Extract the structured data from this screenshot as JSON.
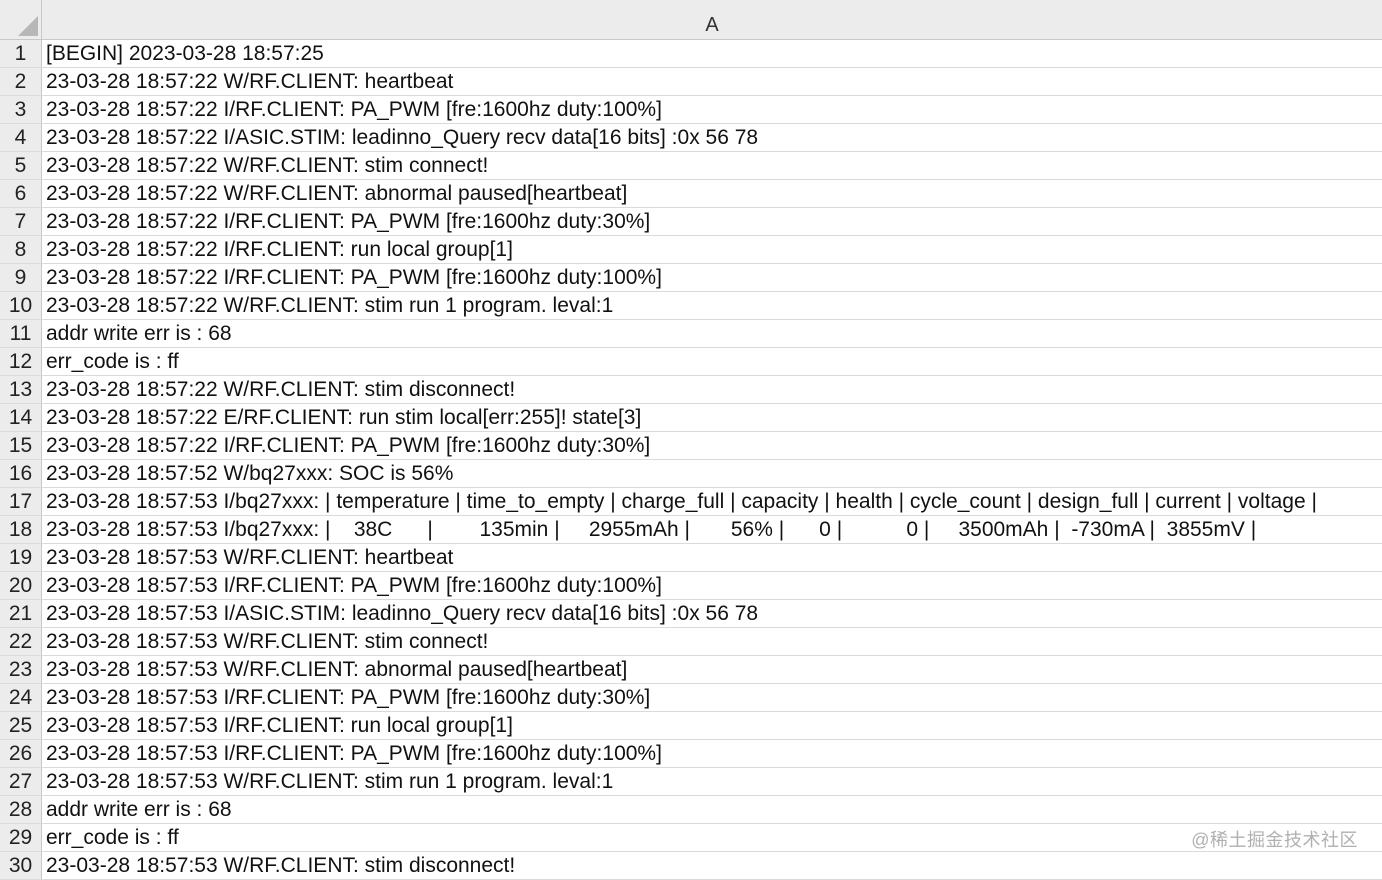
{
  "sheet": {
    "column_header": "A",
    "rows": [
      {
        "num": "1",
        "text": "[BEGIN] 2023-03-28 18:57:25"
      },
      {
        "num": "2",
        "text": "23-03-28 18:57:22 W/RF.CLIENT: heartbeat"
      },
      {
        "num": "3",
        "text": "23-03-28 18:57:22 I/RF.CLIENT: PA_PWM [fre:1600hz duty:100%]"
      },
      {
        "num": "4",
        "text": "23-03-28 18:57:22 I/ASIC.STIM: leadinno_Query recv data[16 bits] :0x 56 78"
      },
      {
        "num": "5",
        "text": "23-03-28 18:57:22 W/RF.CLIENT: stim connect!"
      },
      {
        "num": "6",
        "text": "23-03-28 18:57:22 W/RF.CLIENT: abnormal paused[heartbeat]"
      },
      {
        "num": "7",
        "text": "23-03-28 18:57:22 I/RF.CLIENT: PA_PWM [fre:1600hz duty:30%]"
      },
      {
        "num": "8",
        "text": "23-03-28 18:57:22 I/RF.CLIENT: run local group[1]"
      },
      {
        "num": "9",
        "text": "23-03-28 18:57:22 I/RF.CLIENT: PA_PWM [fre:1600hz duty:100%]"
      },
      {
        "num": "10",
        "text": "23-03-28 18:57:22 W/RF.CLIENT: stim run 1 program. leval:1"
      },
      {
        "num": "11",
        "text": "addr write err is : 68"
      },
      {
        "num": "12",
        "text": "err_code is : ff"
      },
      {
        "num": "13",
        "text": "23-03-28 18:57:22 W/RF.CLIENT: stim disconnect!"
      },
      {
        "num": "14",
        "text": "23-03-28 18:57:22 E/RF.CLIENT: run stim local[err:255]! state[3]"
      },
      {
        "num": "15",
        "text": "23-03-28 18:57:22 I/RF.CLIENT: PA_PWM [fre:1600hz duty:30%]"
      },
      {
        "num": "16",
        "text": "23-03-28 18:57:52 W/bq27xxx: SOC is 56%"
      },
      {
        "num": "17",
        "text": "23-03-28 18:57:53 I/bq27xxx: | temperature | time_to_empty | charge_full | capacity | health | cycle_count | design_full | current | voltage |"
      },
      {
        "num": "18",
        "text": "23-03-28 18:57:53 I/bq27xxx: |    38C      |        135min |     2955mAh |       56% |      0 |           0 |     3500mAh |  -730mA |  3855mV |"
      },
      {
        "num": "19",
        "text": "23-03-28 18:57:53 W/RF.CLIENT: heartbeat"
      },
      {
        "num": "20",
        "text": "23-03-28 18:57:53 I/RF.CLIENT: PA_PWM [fre:1600hz duty:100%]"
      },
      {
        "num": "21",
        "text": "23-03-28 18:57:53 I/ASIC.STIM: leadinno_Query recv data[16 bits] :0x 56 78"
      },
      {
        "num": "22",
        "text": "23-03-28 18:57:53 W/RF.CLIENT: stim connect!"
      },
      {
        "num": "23",
        "text": "23-03-28 18:57:53 W/RF.CLIENT: abnormal paused[heartbeat]"
      },
      {
        "num": "24",
        "text": "23-03-28 18:57:53 I/RF.CLIENT: PA_PWM [fre:1600hz duty:30%]"
      },
      {
        "num": "25",
        "text": "23-03-28 18:57:53 I/RF.CLIENT: run local group[1]"
      },
      {
        "num": "26",
        "text": "23-03-28 18:57:53 I/RF.CLIENT: PA_PWM [fre:1600hz duty:100%]"
      },
      {
        "num": "27",
        "text": "23-03-28 18:57:53 W/RF.CLIENT: stim run 1 program. leval:1"
      },
      {
        "num": "28",
        "text": "addr write err is : 68"
      },
      {
        "num": "29",
        "text": "err_code is : ff"
      },
      {
        "num": "30",
        "text": "23-03-28 18:57:53 W/RF.CLIENT: stim disconnect!"
      }
    ]
  },
  "watermark": "@稀土掘金技术社区"
}
